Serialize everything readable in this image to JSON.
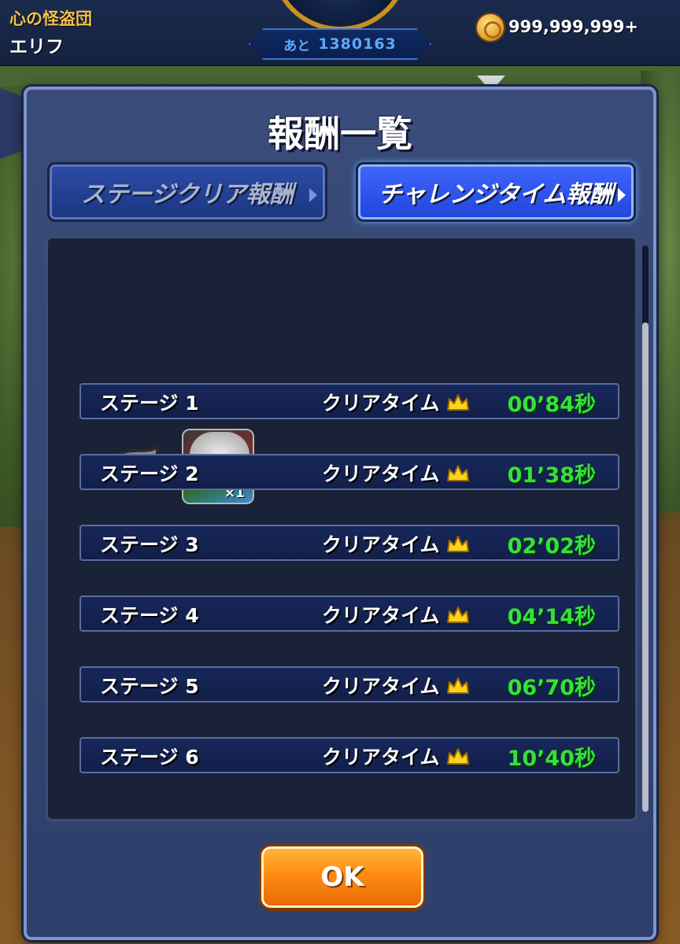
{
  "header": {
    "team_name": "心の怪盗団",
    "player_name": "エリフ",
    "remaining_label": "あと",
    "remaining_value": "1380163",
    "coin_value": "999,999,999+"
  },
  "dialog": {
    "title": "報酬一覧",
    "tabs": [
      {
        "label": "ステージクリア報酬",
        "active": false
      },
      {
        "label": "チャレンジタイム報酬",
        "active": true
      }
    ],
    "reward": {
      "icons": [
        "leaf-village-icon",
        "character-icon"
      ],
      "quantity": "×1"
    },
    "clear_label": "クリアタイム",
    "stages": [
      {
        "label": "ステージ 1",
        "time": "00’84秒"
      },
      {
        "label": "ステージ 2",
        "time": "01’38秒"
      },
      {
        "label": "ステージ 3",
        "time": "02’02秒"
      },
      {
        "label": "ステージ 4",
        "time": "04’14秒"
      },
      {
        "label": "ステージ 5",
        "time": "06’70秒"
      },
      {
        "label": "ステージ 6",
        "time": "10’40秒"
      }
    ],
    "ok_label": "OK"
  },
  "colors": {
    "time_green": "#35e13b",
    "ok_orange": "#ff8c12",
    "active_tab_blue": "#3e66ff",
    "team_name_gold": "#f2c14a"
  }
}
